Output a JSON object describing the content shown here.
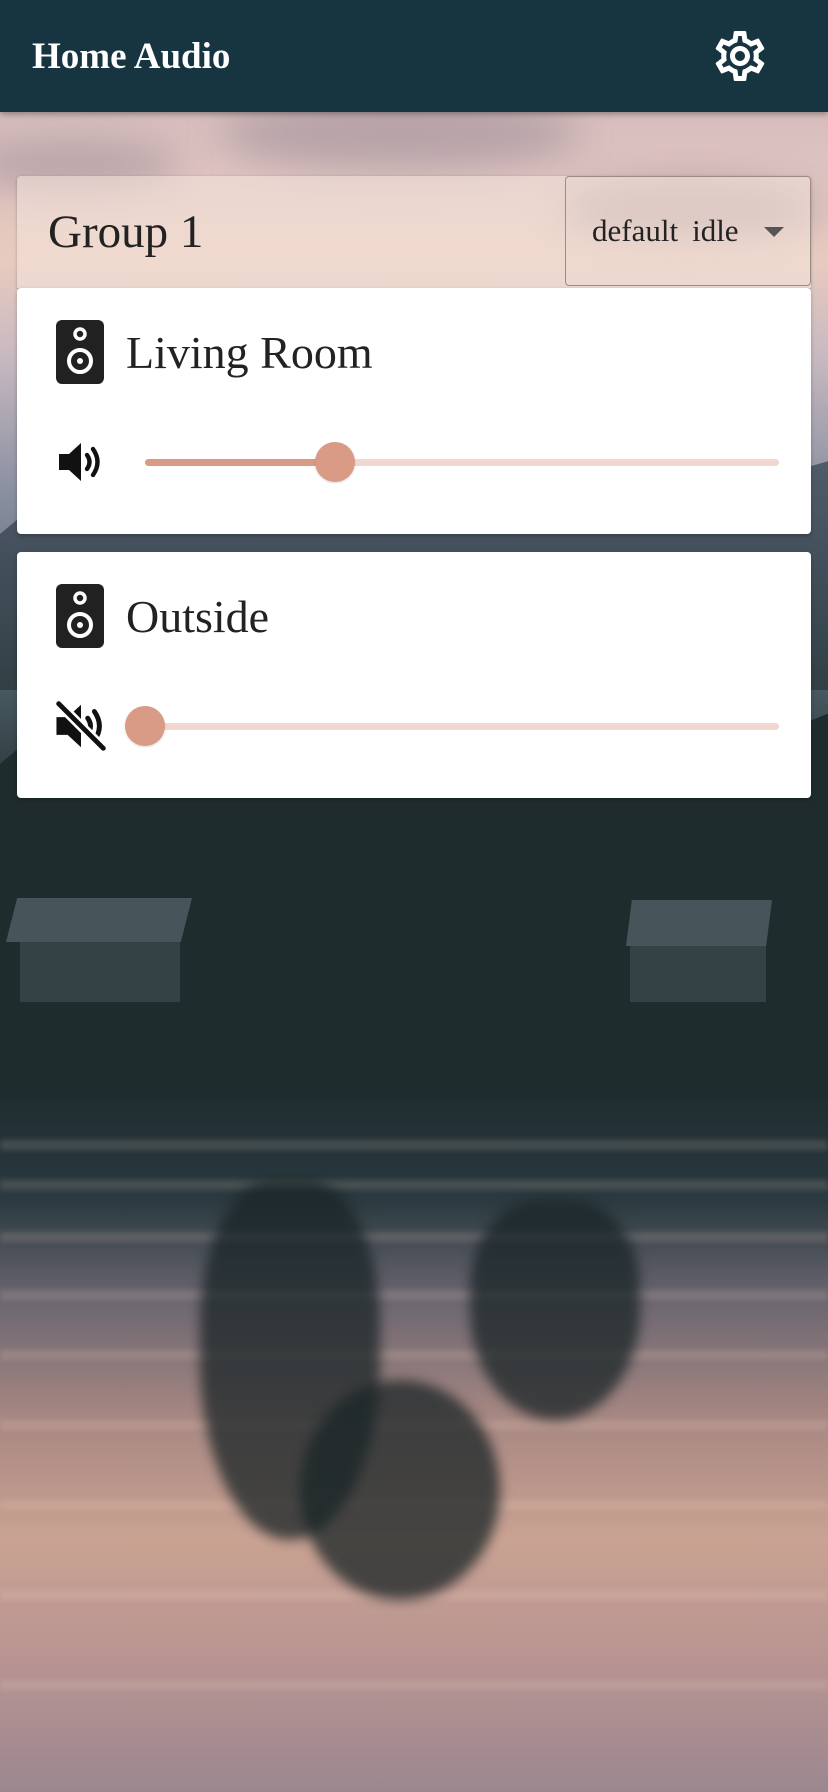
{
  "app_bar": {
    "title": "Home Audio",
    "settings_icon": "gear-icon"
  },
  "group": {
    "title": "Group 1",
    "source_select": {
      "value": "default",
      "state": "idle"
    }
  },
  "zones": [
    {
      "name": "Living Room",
      "icon": "speaker-icon",
      "volume_icon": "volume-up-icon",
      "muted": false,
      "volume": 0.3
    },
    {
      "name": "Outside",
      "icon": "speaker-icon",
      "volume_icon": "volume-off-icon",
      "muted": true,
      "volume": 0
    }
  ],
  "colors": {
    "app_bar": "#163541",
    "slider_accent": "#d99a86",
    "slider_rail": "#f1d7d0"
  }
}
